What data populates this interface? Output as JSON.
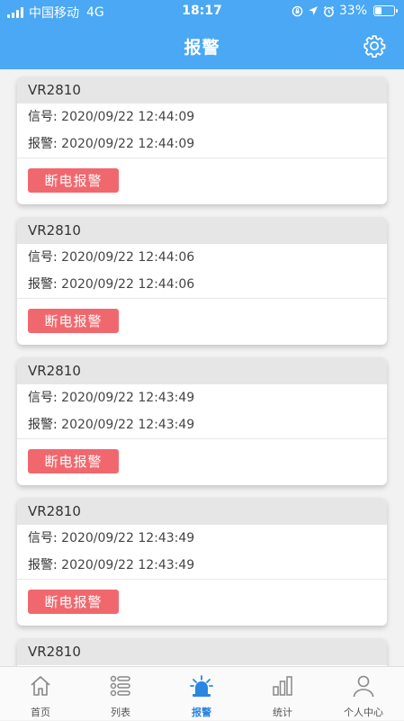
{
  "status": {
    "carrier": "中国移动",
    "network": "4G",
    "time": "18:17",
    "battery": "33%"
  },
  "header": {
    "title": "报警"
  },
  "cards": [
    {
      "device": "VR2810",
      "signal_label": "信号:",
      "signal_time": "2020/09/22 12:44:09",
      "alarm_label": "报警:",
      "alarm_time": "2020/09/22 12:44:09",
      "button": "断电报警"
    },
    {
      "device": "VR2810",
      "signal_label": "信号:",
      "signal_time": "2020/09/22 12:44:06",
      "alarm_label": "报警:",
      "alarm_time": "2020/09/22 12:44:06",
      "button": "断电报警"
    },
    {
      "device": "VR2810",
      "signal_label": "信号:",
      "signal_time": "2020/09/22 12:43:49",
      "alarm_label": "报警:",
      "alarm_time": "2020/09/22 12:43:49",
      "button": "断电报警"
    },
    {
      "device": "VR2810",
      "signal_label": "信号:",
      "signal_time": "2020/09/22 12:43:49",
      "alarm_label": "报警:",
      "alarm_time": "2020/09/22 12:43:49",
      "button": "断电报警"
    },
    {
      "device": "VR2810"
    }
  ],
  "tabs": [
    {
      "label": "首页"
    },
    {
      "label": "列表"
    },
    {
      "label": "报警"
    },
    {
      "label": "统计"
    },
    {
      "label": "个人中心"
    }
  ],
  "colors": {
    "header": "#4aa8f4",
    "alarm_button": "#f0686e",
    "active_tab": "#2a86e0"
  }
}
